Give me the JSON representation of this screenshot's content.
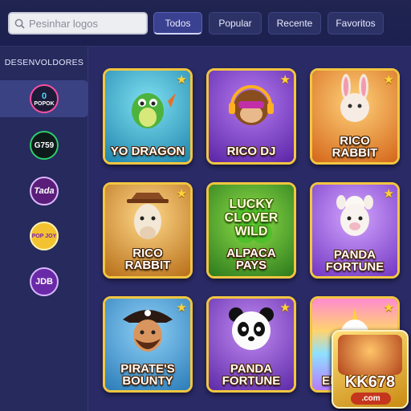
{
  "search": {
    "placeholder": "Pesinhar logos",
    "value": ""
  },
  "tabs": [
    {
      "label": "Todos",
      "active": true
    },
    {
      "label": "Popular",
      "active": false
    },
    {
      "label": "Recente",
      "active": false
    },
    {
      "label": "Favoritos",
      "active": false
    }
  ],
  "sidebar": {
    "title": "DESENVOLDORES",
    "providers": [
      {
        "label": "POPOK",
        "mark": "0",
        "active": true
      },
      {
        "label": "G759",
        "active": false
      },
      {
        "label": "Tada",
        "active": false
      },
      {
        "label": "POP JOY",
        "active": false
      },
      {
        "label": "JDB",
        "active": false
      }
    ]
  },
  "games": [
    {
      "title": "YO DRAGON",
      "art": "dragon-icon",
      "color": "#34a8c9"
    },
    {
      "title": "RICO DJ",
      "art": "monkey-dj-icon",
      "color": "#7a3fc4"
    },
    {
      "title": "RICO RABBIT",
      "art": "rabbit-icon",
      "color": "#e07a1c"
    },
    {
      "title": "RICO RABBIT",
      "art": "alpaca-icon",
      "color": "#d38a22"
    },
    {
      "title": "ALPACA PAYS",
      "art": "clover-icon",
      "color": "#3f9a2a",
      "headline": "LUCKY CLOVER WILD"
    },
    {
      "title": "PANDA FORTUNE",
      "art": "alpaca-icon",
      "color": "#8e56d6"
    },
    {
      "title": "PIRATE'S BOUNTY",
      "art": "pirate-icon",
      "color": "#2f8fcf"
    },
    {
      "title": "PANDA FORTUNE",
      "art": "panda-icon",
      "color": "#7c3fc0"
    },
    {
      "title": "EN U",
      "art": "unicorn-icon",
      "color": "#cf5db6"
    }
  ],
  "brand": {
    "name": "KK678",
    "domain": ".com"
  }
}
